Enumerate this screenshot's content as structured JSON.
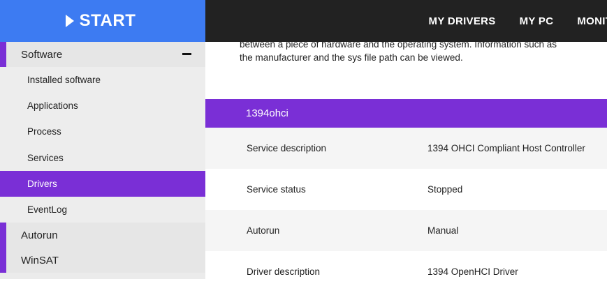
{
  "brand": {
    "label": "START"
  },
  "topnav": {
    "items": [
      "MY DRIVERS",
      "MY PC",
      "MONITOR"
    ]
  },
  "sidebar": {
    "software_label": "Software",
    "software_items": [
      "Installed software",
      "Applications",
      "Process",
      "Services",
      "Drivers",
      "EventLog"
    ],
    "active_item": "Drivers",
    "autorun_label": "Autorun",
    "winsat_label": "WinSAT"
  },
  "main": {
    "intro_line1": "between a piece of hardware and the operating system. Information such as",
    "intro_line2": "the manufacturer and the sys file path can be viewed.",
    "section_title": "1394ohci",
    "rows": [
      {
        "key": "Service description",
        "value": "1394 OHCI Compliant Host Controller"
      },
      {
        "key": "Service status",
        "value": "Stopped"
      },
      {
        "key": "Autorun",
        "value": "Manual"
      },
      {
        "key": "Driver description",
        "value": "1394 OpenHCI Driver"
      }
    ]
  },
  "colors": {
    "accent": "#7a2fd6",
    "brand": "#3d7bf2",
    "topbar": "#222222"
  }
}
